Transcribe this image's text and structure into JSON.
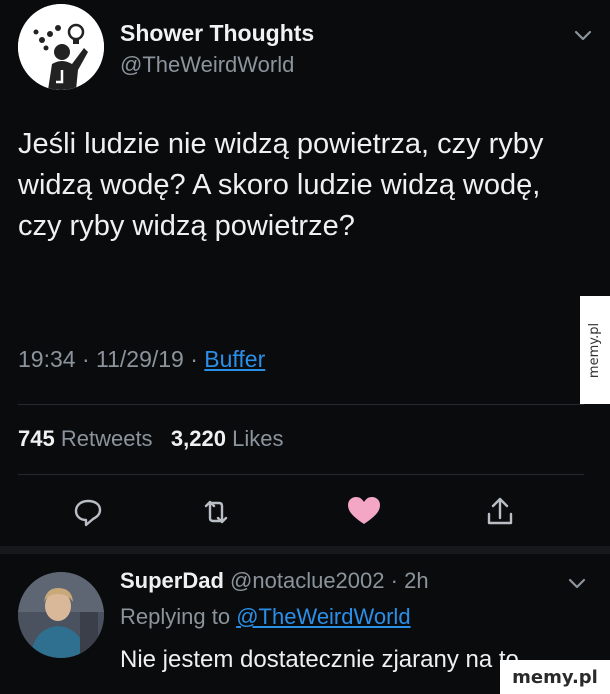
{
  "tweet": {
    "display_name": "Shower Thoughts",
    "handle": "@TheWeirdWorld",
    "text": "Jeśli ludzie nie widzą powietrza, czy ryby widzą wodę? A skoro ludzie widzą wodę, czy ryby widzą powietrze?",
    "time": "19:34",
    "date": "11/29/19",
    "source": "Buffer",
    "retweets_count": "745",
    "retweets_label": "Retweets",
    "likes_count": "3,220",
    "likes_label": "Likes"
  },
  "reply": {
    "display_name": "SuperDad",
    "handle": "@notaclue2002",
    "age": "2h",
    "replying_label": "Replying to",
    "replying_handle": "@TheWeirdWorld",
    "text": "Nie jestem dostatecznie zjarany na to"
  },
  "watermarks": {
    "side": "memy.pl",
    "corner": "memy.pl"
  },
  "colors": {
    "background": "#0a0b0d",
    "link": "#2b8fe8",
    "like_heart": "#f4a7c4",
    "muted": "#8b949c"
  },
  "icons": [
    "chevron-down-icon",
    "reply-icon",
    "retweet-icon",
    "like-heart-icon",
    "share-icon"
  ]
}
